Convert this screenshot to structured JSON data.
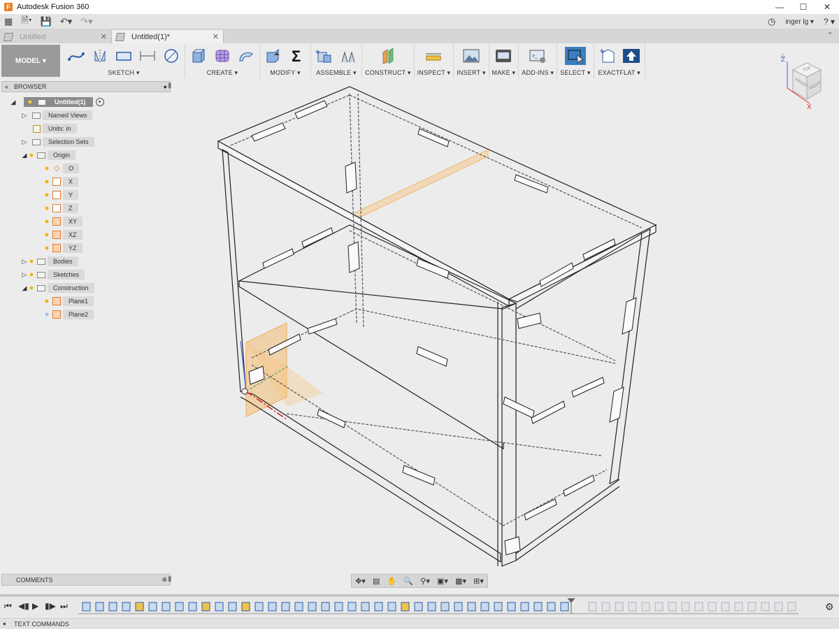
{
  "window": {
    "title": "Autodesk Fusion 360",
    "icon": "fusion-logo-icon"
  },
  "quick_access": {
    "user": "inger lg",
    "help": "?"
  },
  "tabs": [
    {
      "label": "Untitled",
      "active": false
    },
    {
      "label": "Untitled(1)*",
      "active": true
    }
  ],
  "toolbar": {
    "workspace": "MODEL",
    "groups": [
      {
        "label": "SKETCH",
        "icons": [
          "line-icon",
          "mirror-icon",
          "rectangle-icon",
          "dimension-icon",
          "circle-icon"
        ]
      },
      {
        "label": "CREATE",
        "icons": [
          "box-icon",
          "form-icon",
          "revolve-icon"
        ]
      },
      {
        "label": "MODIFY",
        "icons": [
          "press-pull-icon",
          "sigma-icon"
        ]
      },
      {
        "label": "ASSEMBLE",
        "icons": [
          "new-component-icon",
          "joint-icon"
        ]
      },
      {
        "label": "CONSTRUCT",
        "icons": [
          "plane-icon"
        ]
      },
      {
        "label": "INSPECT",
        "icons": [
          "measure-icon"
        ]
      },
      {
        "label": "INSERT",
        "icons": [
          "insert-image-icon"
        ]
      },
      {
        "label": "MAKE",
        "icons": [
          "make-icon"
        ]
      },
      {
        "label": "ADD-INS",
        "icons": [
          "scripts-icon"
        ]
      },
      {
        "label": "SELECT",
        "icons": [
          "select-icon"
        ]
      },
      {
        "label": "EXACTFLAT",
        "icons": [
          "exactflat-icon",
          "upload-icon"
        ]
      }
    ]
  },
  "browser": {
    "title": "BROWSER",
    "root": "Untitled(1)",
    "items": {
      "named_views": "Named Views",
      "units": "Units: in",
      "selection_sets": "Selection Sets",
      "origin": "Origin",
      "o": "O",
      "x": "X",
      "y": "Y",
      "z": "Z",
      "xy": "XY",
      "xz": "XZ",
      "yz": "YZ",
      "bodies": "Bodies",
      "sketches": "Sketches",
      "construction": "Construction",
      "plane1": "Plane1",
      "plane2": "Plane2"
    }
  },
  "viewcube": {
    "top": "TOP",
    "front": "FRONT",
    "right": "RIGHT",
    "z": "Z",
    "x": "X"
  },
  "comments": {
    "title": "COMMENTS"
  },
  "text_commands": {
    "title": "TEXT COMMANDS"
  },
  "colors": {
    "accent": "#f5a33a",
    "select_blue": "#3a7fc1",
    "axis_red": "#e02020"
  }
}
